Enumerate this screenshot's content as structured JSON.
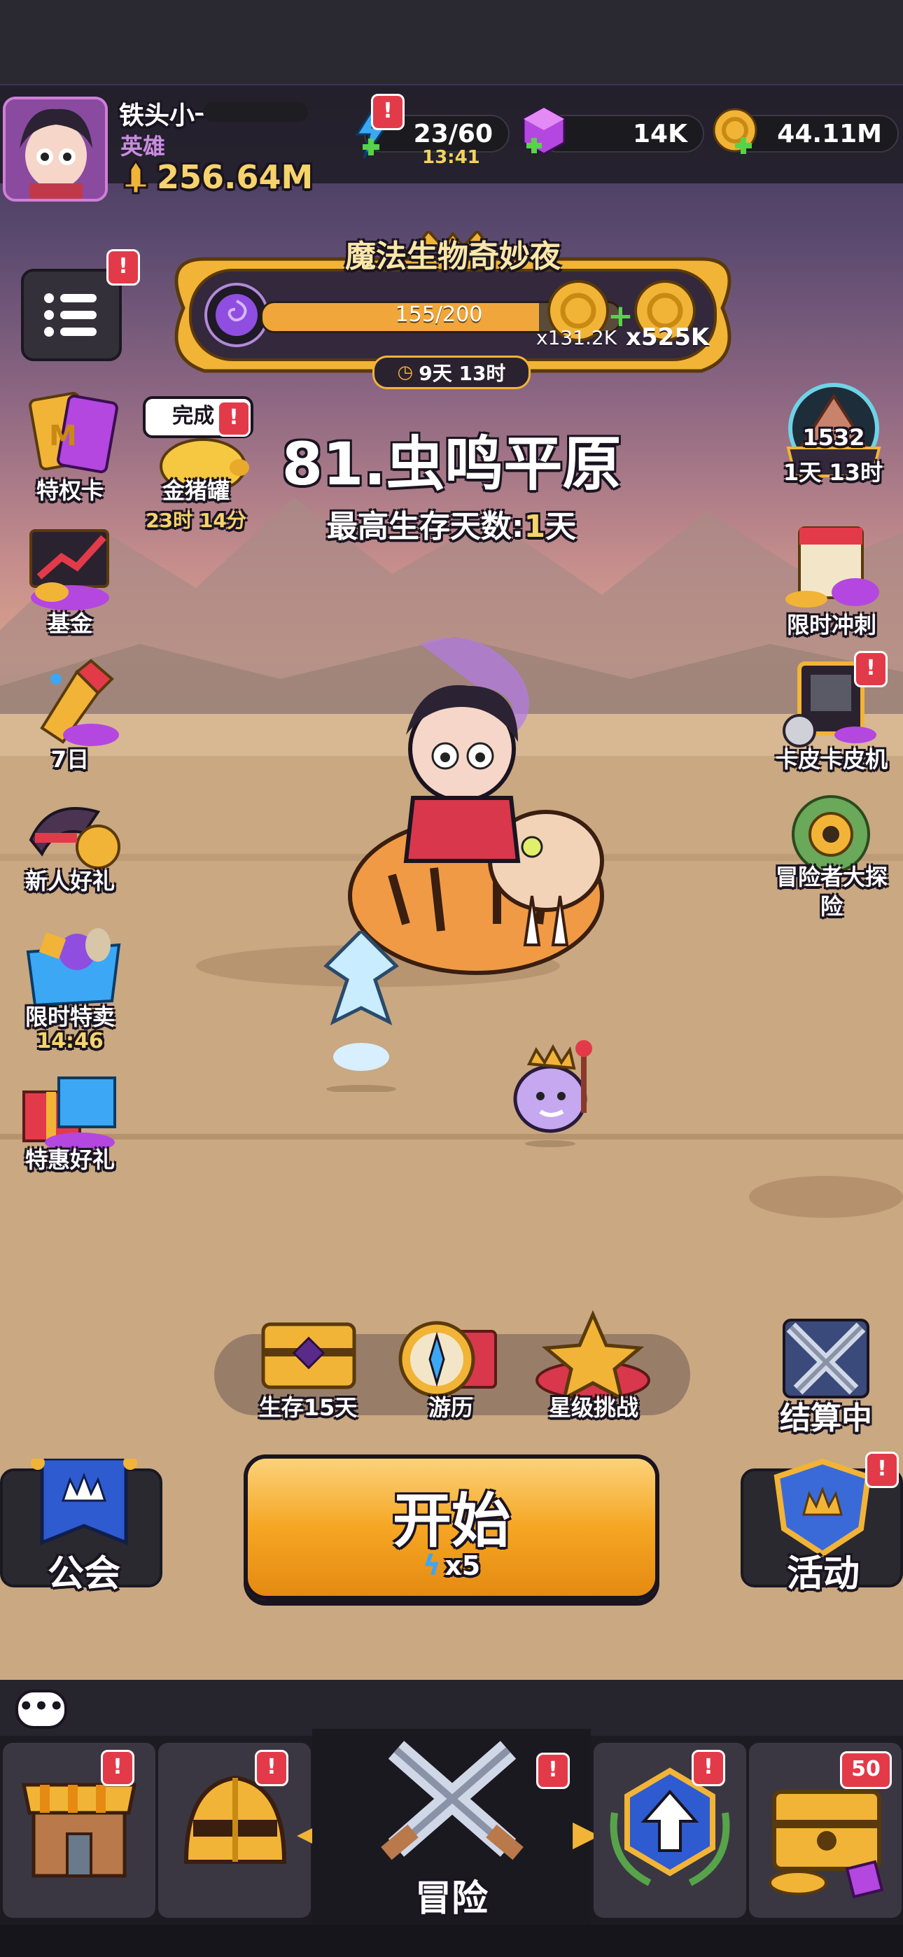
{
  "player": {
    "name": "铁头小一",
    "title": "英雄",
    "power": "256.64M"
  },
  "resources": {
    "energy": "23/60",
    "energy_timer": "13:41",
    "gems": "14K",
    "coins": "44.11M"
  },
  "event": {
    "title": "魔法生物奇妙夜",
    "progress": "155/200",
    "progress_fraction": 0.775,
    "reward1_count": "x131.2K",
    "reward2_count": "x525K",
    "timer": "9天 13时"
  },
  "stage": {
    "name": "81.虫鸣平原",
    "best_label": "最高生存天数:",
    "best_value": "1",
    "best_unit": "天"
  },
  "left_menu": [
    {
      "label": "特权卡",
      "icon": "privilege-card-icon"
    },
    {
      "label": "基金",
      "icon": "fund-chart-icon"
    },
    {
      "label": "7日",
      "icon": "seven-day-gift-icon"
    },
    {
      "label": "新人好礼",
      "icon": "newbie-gift-icon"
    },
    {
      "label": "限时特卖",
      "sub": "14:46",
      "icon": "limited-sale-icon"
    },
    {
      "label": "特惠好礼",
      "icon": "special-gift-icon"
    }
  ],
  "piggy": {
    "bubble": "完成!",
    "label": "金猪罐",
    "timer": "23时 14分"
  },
  "right_menu": [
    {
      "label": "1532",
      "sub": "1天 13时",
      "icon": "rank-pyramid-icon"
    },
    {
      "label": "限时冲刺",
      "icon": "sprint-calendar-icon"
    },
    {
      "label": "卡皮卡皮机",
      "icon": "capsule-machine-icon"
    },
    {
      "label": "冒险者大探险",
      "icon": "explorer-map-icon"
    }
  ],
  "quests": [
    {
      "label": "生存15天",
      "icon": "chest-icon"
    },
    {
      "label": "游历",
      "icon": "compass-icon"
    },
    {
      "label": "星级挑战",
      "icon": "star-challenge-icon"
    }
  ],
  "settle": {
    "label": "结算中"
  },
  "guild": {
    "label": "公会"
  },
  "start": {
    "label": "开始",
    "cost": "x5"
  },
  "activity": {
    "label": "活动"
  },
  "nav": {
    "adventure_label": "冒险",
    "chest_badge": "50"
  },
  "colors": {
    "gold": "#f2b437",
    "start_orange": "#f5a623",
    "badge_red": "#e33a4a",
    "bar_fill": "#f0a63a"
  }
}
